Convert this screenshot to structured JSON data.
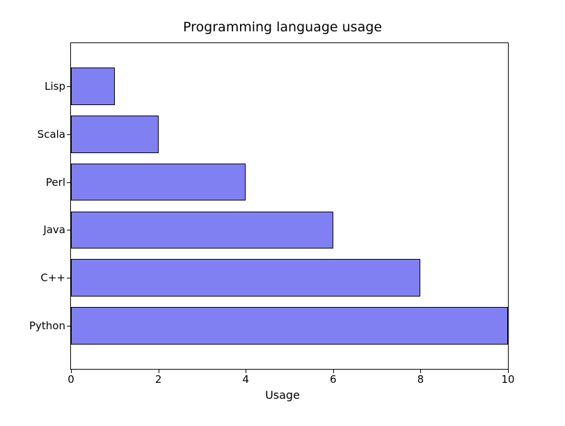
{
  "chart_data": {
    "type": "bar",
    "orientation": "horizontal",
    "title": "Programming language usage",
    "xlabel": "Usage",
    "ylabel": "",
    "categories": [
      "Python",
      "C++",
      "Java",
      "Perl",
      "Scala",
      "Lisp"
    ],
    "values": [
      10,
      8,
      6,
      4,
      2,
      1
    ],
    "xlim": [
      0,
      10
    ],
    "xticks": [
      0,
      2,
      4,
      6,
      8,
      10
    ],
    "bar_color": "#8080f2"
  }
}
